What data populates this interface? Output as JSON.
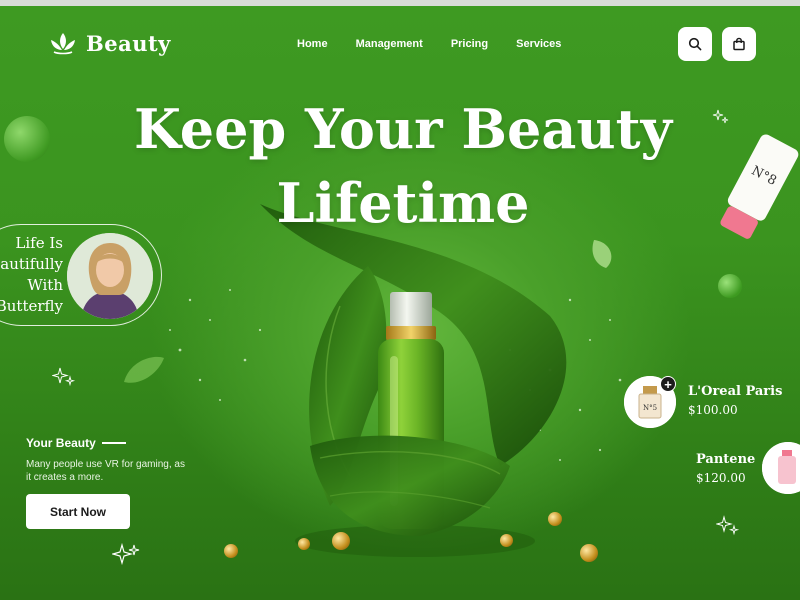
{
  "brand": {
    "name": "Beauty",
    "logo_icon": "lotus-icon"
  },
  "nav": {
    "items": [
      "Home",
      "Management",
      "Pricing",
      "Services"
    ]
  },
  "header_actions": {
    "search_icon": "search-icon",
    "cart_icon": "shopping-bag-icon"
  },
  "hero": {
    "title_line1": "Keep Your Beauty",
    "title_line2": "Lifetime"
  },
  "testimonial": {
    "line1": "Life Is",
    "line2": "autifully",
    "line3": "With",
    "line4": "Butterfly"
  },
  "intro": {
    "heading": "Your Beauty",
    "text": "Many people use VR for gaming, as it creates a more.",
    "cta_label": "Start Now"
  },
  "products": [
    {
      "name": "L'Oreal Paris",
      "price": "$100.00"
    },
    {
      "name": "Pantene",
      "price": "$120.00"
    }
  ],
  "colors": {
    "background": "#3e9a22",
    "accent": "#ffffff",
    "tube_cap": "#f07890"
  }
}
